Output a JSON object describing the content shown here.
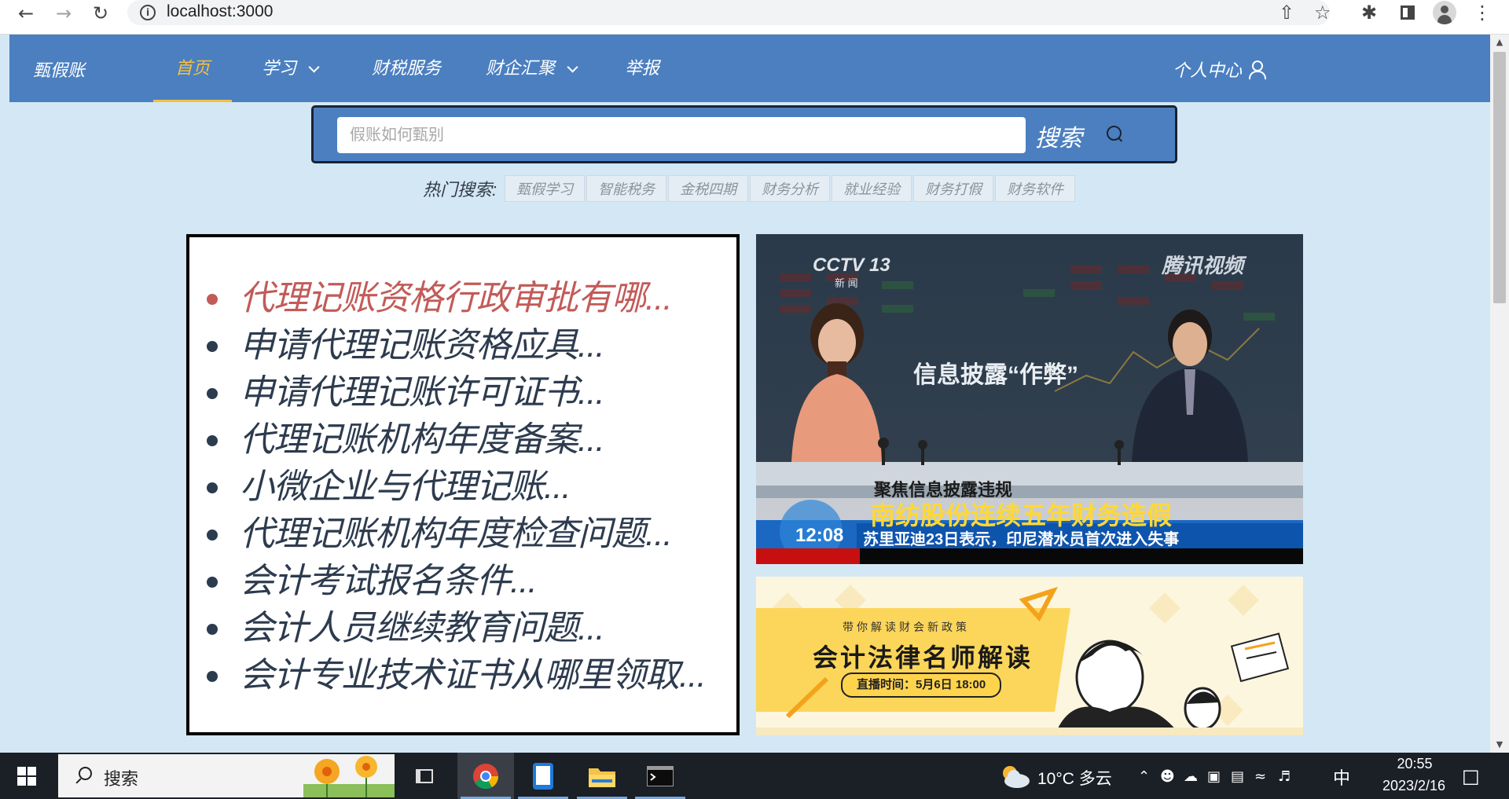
{
  "browser": {
    "url": "localhost:3000"
  },
  "site": {
    "logo": "甄假账",
    "nav": [
      {
        "label": "首页",
        "active": true,
        "has_dropdown": false
      },
      {
        "label": "学习",
        "active": false,
        "has_dropdown": true
      },
      {
        "label": "财税服务",
        "active": false,
        "has_dropdown": false
      },
      {
        "label": "财企汇聚",
        "active": false,
        "has_dropdown": true
      },
      {
        "label": "举报",
        "active": false,
        "has_dropdown": false
      }
    ],
    "user_center": "个人中心",
    "accent_color": "#4b7fc0",
    "active_color": "#f2c144"
  },
  "search": {
    "placeholder": "假账如何甄别",
    "button_label": "搜索",
    "hot_label": "热门搜索:",
    "hot_tags": [
      "甄假学习",
      "智能税务",
      "金税四期",
      "财务分析",
      "就业经验",
      "财务打假",
      "财务软件"
    ]
  },
  "articles": [
    {
      "title": "代理记账资格行政审批有哪...",
      "active": true
    },
    {
      "title": "申请代理记账资格应具...",
      "active": false
    },
    {
      "title": "申请代理记账许可证书...",
      "active": false
    },
    {
      "title": "代理记账机构年度备案...",
      "active": false
    },
    {
      "title": "小微企业与代理记账...",
      "active": false
    },
    {
      "title": "代理记账机构年度检查问题...",
      "active": false
    },
    {
      "title": "会计考试报名条件...",
      "active": false
    },
    {
      "title": "会计人员继续教育问题...",
      "active": false
    },
    {
      "title": "会计专业技术证书从哪里领取...",
      "active": false
    }
  ],
  "news_image": {
    "channel": "CCTV 13",
    "channel_sub": "新 闻",
    "watermark": "腾讯视频",
    "headline": "信息披露“作弊”",
    "caption_top": "聚焦信息披露违规",
    "caption_main": "南纺股份连续五年财务造假",
    "time": "12:08",
    "ticker": "苏里亚迪23日表示，印尼潜水员首次进入失事"
  },
  "promo": {
    "subtitle": "带你解读财会新政策",
    "title": "会计法律名师解读",
    "schedule": "直播时间：5月6日 18:00"
  },
  "taskbar": {
    "search_label": "搜索",
    "weather": "10°C  多云",
    "ime": "中",
    "time": "20:55",
    "date": "2023/2/16"
  }
}
